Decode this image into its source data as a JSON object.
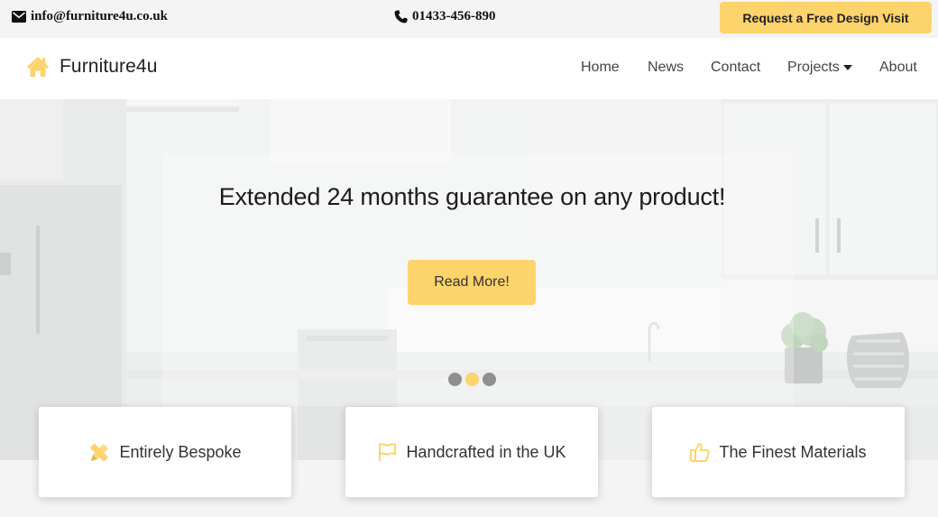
{
  "topbar": {
    "email": "info@furniture4u.co.uk",
    "phone": "01433-456-890",
    "cta_label": "Request a Free Design Visit"
  },
  "brand": {
    "name": "Furniture4u"
  },
  "nav": {
    "home": "Home",
    "news": "News",
    "contact": "Contact",
    "projects": "Projects",
    "about": "About"
  },
  "hero": {
    "title": "Extended 24 months guarantee on any product!",
    "button_label": "Read More!",
    "slides_total": 3,
    "active_slide": 2
  },
  "features": [
    {
      "label": "Entirely Bespoke",
      "icon": "pencil-ruler-icon"
    },
    {
      "label": "Handcrafted in the UK",
      "icon": "flag-icon"
    },
    {
      "label": "The Finest Materials",
      "icon": "thumbs-up-icon"
    }
  ],
  "colors": {
    "accent": "#fdd36b",
    "text": "#333333",
    "topbar_bg": "#f4f4f4"
  }
}
